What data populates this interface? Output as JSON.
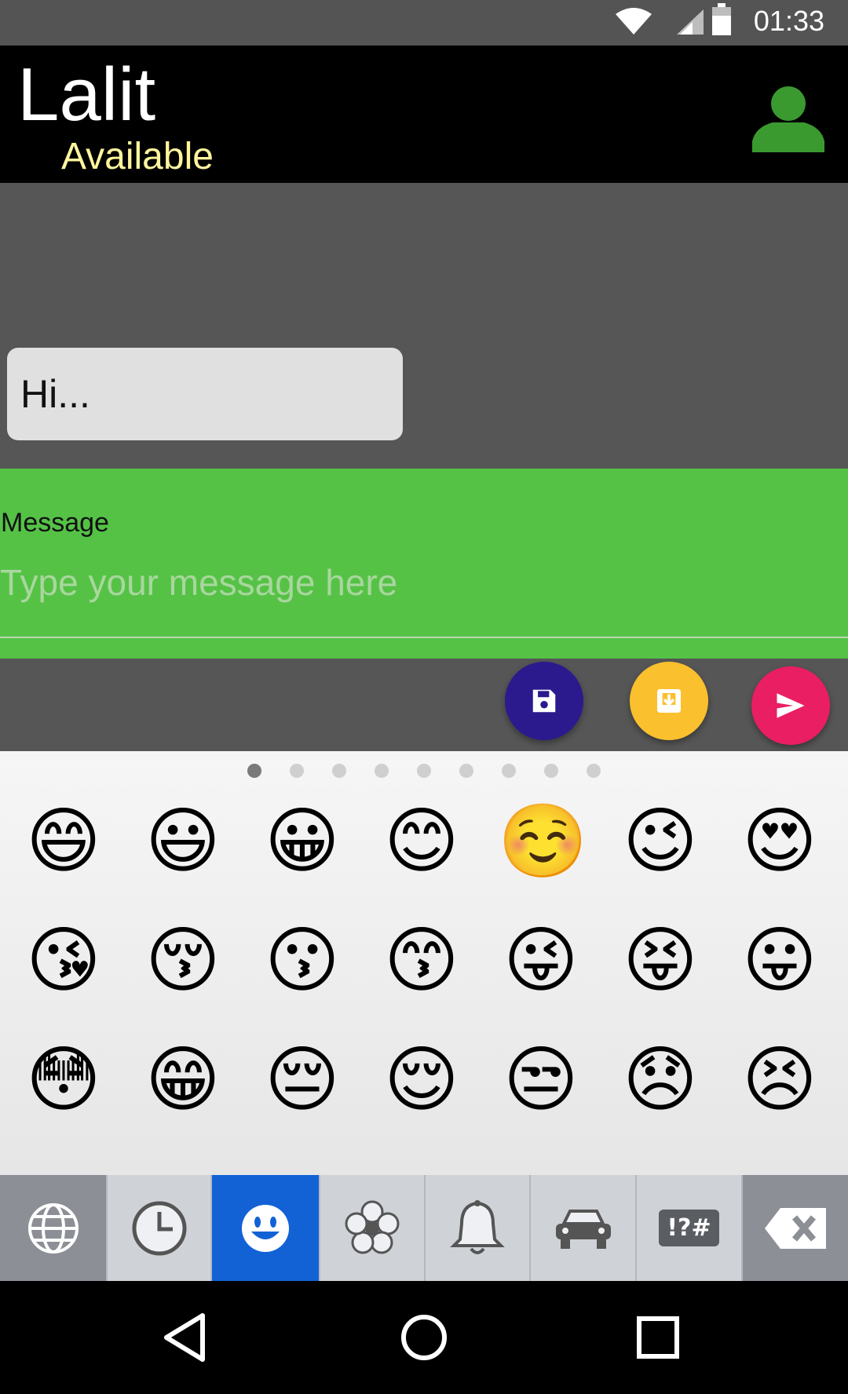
{
  "status_bar": {
    "time": "01:33"
  },
  "header": {
    "contact_name": "Lalit",
    "contact_status": "Available"
  },
  "chat": {
    "messages": [
      {
        "text": "Hi..."
      }
    ]
  },
  "compose": {
    "label": "Message",
    "placeholder": "Type your message here",
    "value": ""
  },
  "emoji_pages": {
    "count": 9,
    "active_index": 0
  },
  "emoji_grid": [
    "😄",
    "😃",
    "😀",
    "😊",
    "☺️",
    "😉",
    "😍",
    "😘",
    "😚",
    "😗",
    "😙",
    "😜",
    "😝",
    "😛",
    "😳",
    "😁",
    "😔",
    "😌",
    "😒",
    "😞",
    "😣"
  ],
  "tabs": [
    {
      "icon": "globe-icon"
    },
    {
      "icon": "clock-icon"
    },
    {
      "icon": "smiley-icon",
      "selected": true
    },
    {
      "icon": "flower-icon"
    },
    {
      "icon": "bell-icon"
    },
    {
      "icon": "car-icon"
    },
    {
      "icon": "symbols-icon",
      "label": "!?#"
    },
    {
      "icon": "backspace-icon"
    }
  ],
  "colors": {
    "header_bg": "#000000",
    "status_text": "#fff59d",
    "compose_bg": "#55c246",
    "save_fab": "#2a1a8e",
    "archive_fab": "#fbc02d",
    "send_fab": "#e91e63",
    "tab_selected": "#1262d6"
  }
}
